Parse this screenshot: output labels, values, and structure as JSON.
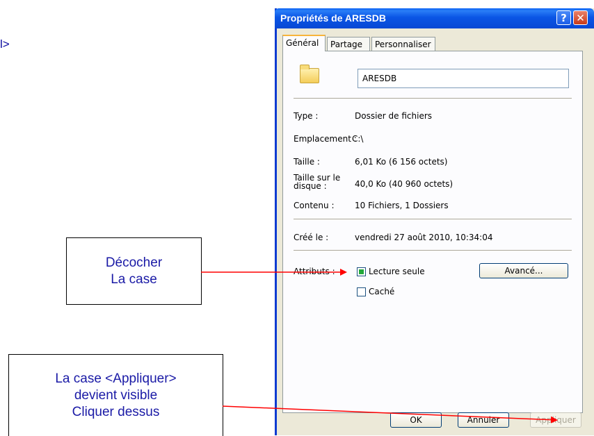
{
  "left_fragment": "l>",
  "annotations": {
    "note1": [
      "Décocher",
      "La case"
    ],
    "note2": [
      "La case <Appliquer>",
      "devient visible",
      "Cliquer dessus"
    ]
  },
  "dialog": {
    "title": "Propriétés de ARESDB",
    "help_glyph": "?",
    "close_glyph": "✕",
    "tabs": [
      "Général",
      "Partage",
      "Personnaliser"
    ],
    "name": "ARESDB",
    "props": {
      "type_label": "Type :",
      "type_value": "Dossier de fichiers",
      "location_label": "Emplacement :",
      "location_value": "C:\\",
      "size_label": "Taille :",
      "size_value": "6,01 Ko (6 156 octets)",
      "disk_size_label": "Taille sur le disque :",
      "disk_size_value": "40,0 Ko (40 960 octets)",
      "contents_label": "Contenu :",
      "contents_value": "10 Fichiers, 1 Dossiers",
      "created_label": "Créé le :",
      "created_value": "vendredi 27 août 2010, 10:34:04",
      "attributes_label": "Attributs :"
    },
    "checkboxes": {
      "readonly": "Lecture seule",
      "hidden": "Caché"
    },
    "advanced_button": "Avancé...",
    "buttons": {
      "ok": "OK",
      "cancel": "Annuler",
      "apply": "Appliquer"
    }
  },
  "colors": {
    "titlebar": "#0a55e5",
    "annotation_text": "#1a1aa6",
    "arrow": "#ff0000"
  }
}
